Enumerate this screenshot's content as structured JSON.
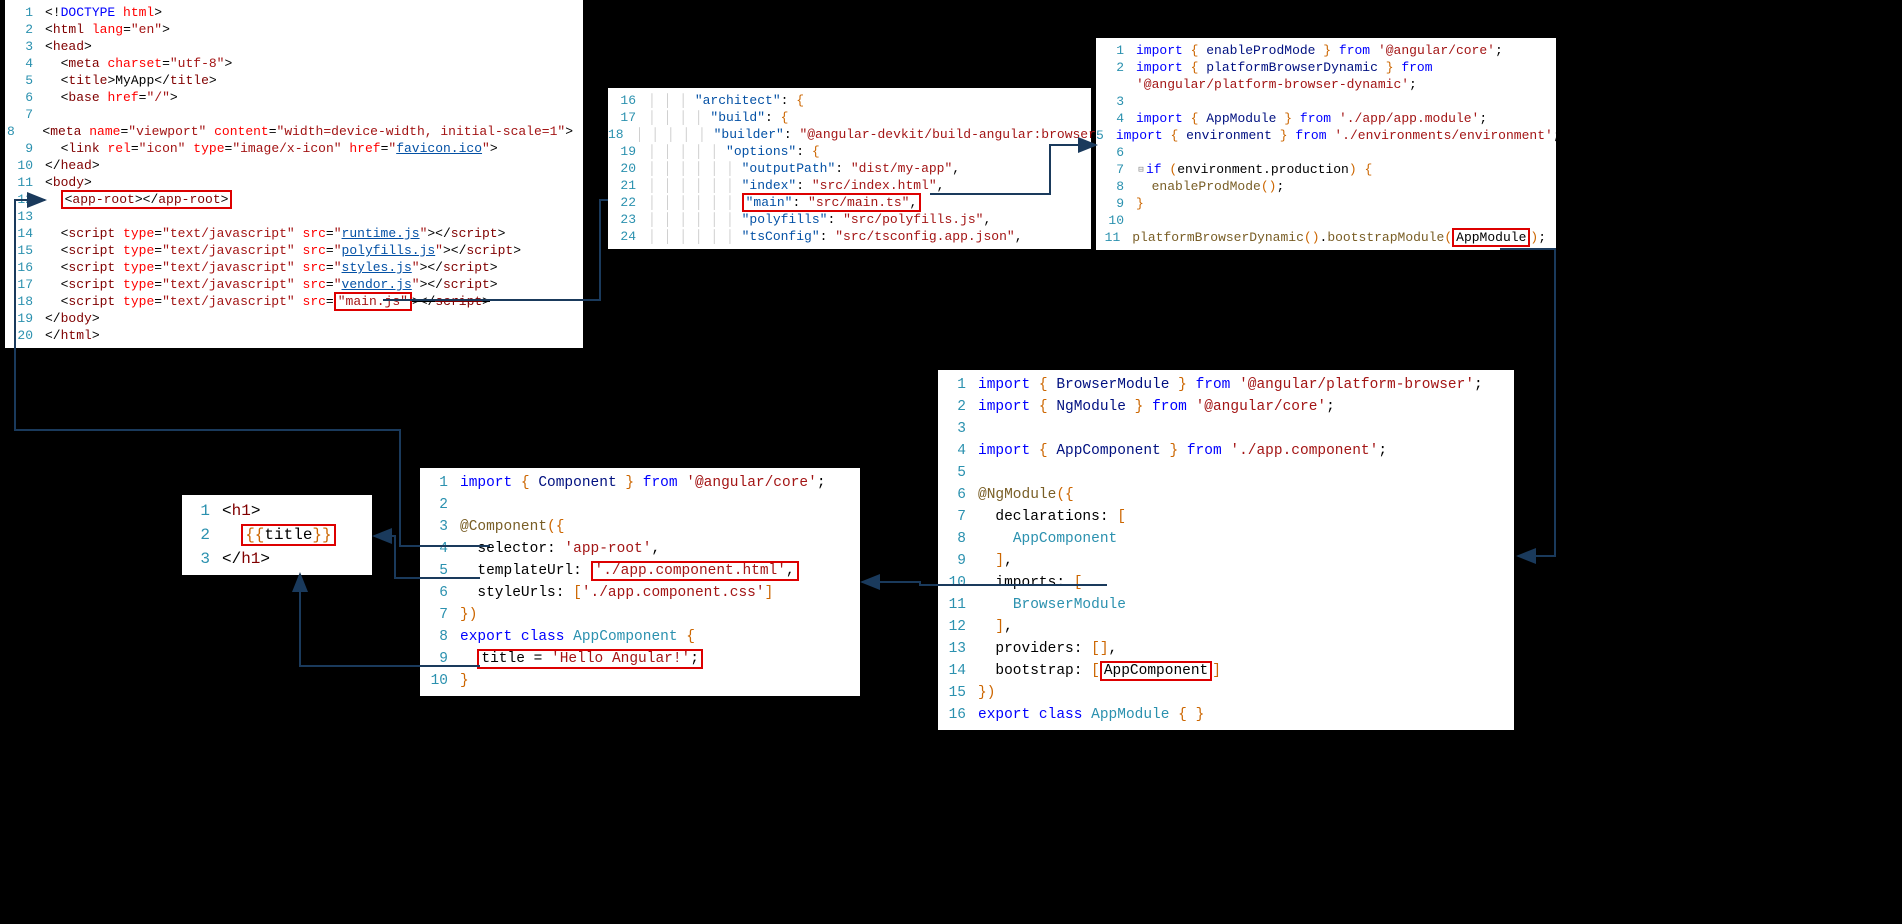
{
  "panel_index_html": {
    "lines": [
      {
        "n": "1",
        "html": "<span class='punct'>&lt;!</span><span class='kw'>DOCTYPE</span> <span class='attr'>html</span><span class='punct'>&gt;</span>"
      },
      {
        "n": "2",
        "html": "<span class='punct'>&lt;</span><span class='tag'>html</span> <span class='attr'>lang</span><span class='punct'>=</span><span class='str'>\"en\"</span><span class='punct'>&gt;</span>"
      },
      {
        "n": "3",
        "html": "<span class='punct'>&lt;</span><span class='tag'>head</span><span class='punct'>&gt;</span>"
      },
      {
        "n": "4",
        "html": "  <span class='punct'>&lt;</span><span class='tag'>meta</span> <span class='attr'>charset</span><span class='punct'>=</span><span class='str'>\"utf-8\"</span><span class='punct'>&gt;</span>"
      },
      {
        "n": "5",
        "html": "  <span class='punct'>&lt;</span><span class='tag'>title</span><span class='punct'>&gt;</span>MyApp<span class='punct'>&lt;/</span><span class='tag'>title</span><span class='punct'>&gt;</span>"
      },
      {
        "n": "6",
        "html": "  <span class='punct'>&lt;</span><span class='tag'>base</span> <span class='attr'>href</span><span class='punct'>=</span><span class='str'>\"/\"</span><span class='punct'>&gt;</span>"
      },
      {
        "n": "7",
        "html": " "
      },
      {
        "n": "8",
        "html": "  <span class='punct'>&lt;</span><span class='tag'>meta</span> <span class='attr'>name</span><span class='punct'>=</span><span class='str'>\"viewport\"</span> <span class='attr'>content</span><span class='punct'>=</span><span class='str'>\"width=device-width, initial-scale=1\"</span><span class='punct'>&gt;</span>"
      },
      {
        "n": "9",
        "html": "  <span class='punct'>&lt;</span><span class='tag'>link</span> <span class='attr'>rel</span><span class='punct'>=</span><span class='str'>\"icon\"</span> <span class='attr'>type</span><span class='punct'>=</span><span class='str'>\"image/x-icon\"</span> <span class='attr'>href</span><span class='punct'>=</span><span class='str'>\"<span class='link'>favicon.ico</span>\"</span><span class='punct'>&gt;</span>"
      },
      {
        "n": "10",
        "html": "<span class='punct'>&lt;/</span><span class='tag'>head</span><span class='punct'>&gt;</span>"
      },
      {
        "n": "11",
        "html": "<span class='punct'>&lt;</span><span class='tag'>body</span><span class='punct'>&gt;</span>"
      },
      {
        "n": "12",
        "html": "  <span class='red-box'><span class='punct'>&lt;</span><span class='tag'>app-root</span><span class='punct'>&gt;&lt;/</span><span class='tag'>app-root</span><span class='punct'>&gt;</span></span>"
      },
      {
        "n": "13",
        "html": " "
      },
      {
        "n": "14",
        "html": "  <span class='punct'>&lt;</span><span class='tag'>script</span> <span class='attr'>type</span><span class='punct'>=</span><span class='str'>\"text/javascript\"</span> <span class='attr'>src</span><span class='punct'>=</span><span class='str'>\"<span class='link'>runtime.js</span>\"</span><span class='punct'>&gt;&lt;/</span><span class='tag'>script</span><span class='punct'>&gt;</span>"
      },
      {
        "n": "15",
        "html": "  <span class='punct'>&lt;</span><span class='tag'>script</span> <span class='attr'>type</span><span class='punct'>=</span><span class='str'>\"text/javascript\"</span> <span class='attr'>src</span><span class='punct'>=</span><span class='str'>\"<span class='link'>polyfills.js</span>\"</span><span class='punct'>&gt;&lt;/</span><span class='tag'>script</span><span class='punct'>&gt;</span>"
      },
      {
        "n": "16",
        "html": "  <span class='punct'>&lt;</span><span class='tag'>script</span> <span class='attr'>type</span><span class='punct'>=</span><span class='str'>\"text/javascript\"</span> <span class='attr'>src</span><span class='punct'>=</span><span class='str'>\"<span class='link'>styles.js</span>\"</span><span class='punct'>&gt;&lt;/</span><span class='tag'>script</span><span class='punct'>&gt;</span>"
      },
      {
        "n": "17",
        "html": "  <span class='punct'>&lt;</span><span class='tag'>script</span> <span class='attr'>type</span><span class='punct'>=</span><span class='str'>\"text/javascript\"</span> <span class='attr'>src</span><span class='punct'>=</span><span class='str'>\"<span class='link'>vendor.js</span>\"</span><span class='punct'>&gt;&lt;/</span><span class='tag'>script</span><span class='punct'>&gt;</span>"
      },
      {
        "n": "18",
        "html": "  <span class='punct'>&lt;</span><span class='tag'>script</span> <span class='attr'>type</span><span class='punct'>=</span><span class='str'>\"text/javascript\"</span> <span class='attr'>src</span><span class='punct'>=</span><span class='red-box'><span class='str'>\"main.js\"</span></span><span class='punct' style='text-decoration:line-through'>&gt;&lt;/</span><span class='tag' style='text-decoration:line-through'>script</span><span class='punct' style='text-decoration:line-through'>&gt;</span>"
      },
      {
        "n": "19",
        "html": "<span class='punct'>&lt;/</span><span class='tag'>body</span><span class='punct'>&gt;</span>"
      },
      {
        "n": "20",
        "html": "<span class='punct'>&lt;/</span><span class='tag'>html</span><span class='punct'>&gt;</span>"
      }
    ]
  },
  "panel_angular_json": {
    "lines": [
      {
        "n": "16",
        "html": "<span class='guide'>│ │ │ </span><span class='str2'>\"architect\"</span>: <span class='brace-y'>{</span>"
      },
      {
        "n": "17",
        "html": "<span class='guide'>│ │ │ │ </span><span class='str2'>\"build\"</span>: <span class='brace-y'>{</span>"
      },
      {
        "n": "18",
        "html": "<span class='guide'>│ │ │ │ │ </span><span class='str2'>\"builder\"</span>: <span class='str'>\"@angular-devkit/build-angular:browser\"</span>,"
      },
      {
        "n": "19",
        "html": "<span class='guide'>│ │ │ │ │ </span><span class='str2'>\"options\"</span>: <span class='brace-y'>{</span>"
      },
      {
        "n": "20",
        "html": "<span class='guide'>│ │ │ │ │ │ </span><span class='str2'>\"outputPath\"</span>: <span class='str'>\"dist/my-app\"</span>,"
      },
      {
        "n": "21",
        "html": "<span class='guide'>│ │ │ │ │ │ </span><span class='str2'>\"index\"</span>: <span class='str'>\"src/index.html\"</span>,"
      },
      {
        "n": "22",
        "html": "<span class='guide'>│ │ │ │ │ │ </span><span class='red-box'><span class='str2'>\"main\"</span>: <span class='str'>\"src/main.ts\"</span>,</span>"
      },
      {
        "n": "23",
        "html": "<span class='guide'>│ │ │ │ │ │ </span><span class='str2'>\"polyfills\"</span>: <span class='str'>\"src/polyfills.js\"</span>,"
      },
      {
        "n": "24",
        "html": "<span class='guide'>│ │ │ │ │ │ </span><span class='str2'>\"tsConfig\"</span>: <span class='str'>\"src/tsconfig.app.json\"</span>,"
      }
    ]
  },
  "panel_main_ts": {
    "lines": [
      {
        "n": "1",
        "html": "<span class='kw'>import</span> <span class='brace-y'>{</span> <span class='prop'>enableProdMode</span> <span class='brace-y'>}</span> <span class='kw'>from</span> <span class='str'>'@angular/core'</span>;"
      },
      {
        "n": "2",
        "html": "<span class='kw'>import</span> <span class='brace-y'>{</span> <span class='prop'>platformBrowserDynamic</span> <span class='brace-y'>}</span> <span class='kw'>from</span>"
      },
      {
        "n": "",
        "html": "<span class='str'>'@angular/platform-browser-dynamic'</span>;"
      },
      {
        "n": "3",
        "html": " "
      },
      {
        "n": "4",
        "html": "<span class='kw'>import</span> <span class='brace-y'>{</span> <span class='prop'>AppModule</span> <span class='brace-y'>}</span> <span class='kw'>from</span> <span class='str'>'./app/app.module'</span>;"
      },
      {
        "n": "5",
        "html": "<span class='kw'>import</span> <span class='brace-y'>{</span> <span class='prop'>environment</span> <span class='brace-y'>}</span> <span class='kw'>from</span> <span class='str'>'./environments/environment'</span>;"
      },
      {
        "n": "6",
        "html": " "
      },
      {
        "n": "7",
        "html": "<span class='kw'>if</span> <span class='brace-y'>(</span>environment.production<span class='brace-y'>)</span> <span class='brace-y'>{</span>",
        "fold": "⊟"
      },
      {
        "n": "8",
        "html": "  <span class='func'>enableProdMode</span><span class='brace-y'>()</span>;"
      },
      {
        "n": "9",
        "html": "<span class='brace-y'>}</span>"
      },
      {
        "n": "10",
        "html": " "
      },
      {
        "n": "11",
        "html": "<span class='func'>platformBrowserDynamic</span><span class='brace-y'>()</span>.<span class='func'>bootstrapModule</span><span class='brace-y'>(</span><span class='red-box'>AppModule</span><span class='brace-y'>)</span>;"
      }
    ]
  },
  "panel_app_module": {
    "lines": [
      {
        "n": "1",
        "html": "<span class='kw'>import</span> <span class='brace-y'>{</span> <span class='prop'>BrowserModule</span> <span class='brace-y'>}</span> <span class='kw'>from</span> <span class='str'>'@angular/platform-browser'</span>;"
      },
      {
        "n": "2",
        "html": "<span class='kw'>import</span> <span class='brace-y'>{</span> <span class='prop'>NgModule</span> <span class='brace-y'>}</span> <span class='kw'>from</span> <span class='str'>'@angular/core'</span>;"
      },
      {
        "n": "3",
        "html": " "
      },
      {
        "n": "4",
        "html": "<span class='kw'>import</span> <span class='brace-y'>{</span> <span class='prop'>AppComponent</span> <span class='brace-y'>}</span> <span class='kw'>from</span> <span class='str'>'./app.component'</span>;"
      },
      {
        "n": "5",
        "html": " "
      },
      {
        "n": "6",
        "html": "<span class='deco'>@NgModule</span><span class='brace-y'>({</span>"
      },
      {
        "n": "7",
        "html": "  declarations: <span class='brace-y'>[</span>"
      },
      {
        "n": "8",
        "html": "    <span class='type'>AppComponent</span>"
      },
      {
        "n": "9",
        "html": "  <span class='brace-y'>]</span>,"
      },
      {
        "n": "10",
        "html": "  imports: <span class='brace-y'>[</span>"
      },
      {
        "n": "11",
        "html": "    <span class='type'>BrowserModule</span>"
      },
      {
        "n": "12",
        "html": "  <span class='brace-y'>]</span>,"
      },
      {
        "n": "13",
        "html": "  providers: <span class='brace-y'>[]</span>,"
      },
      {
        "n": "14",
        "html": "  bootstrap: <span class='brace-y'>[</span><span class='red-box'>AppComponent</span><span class='brace-y'>]</span>"
      },
      {
        "n": "15",
        "html": "<span class='brace-y'>})</span>"
      },
      {
        "n": "16",
        "html": "<span class='kw'>export</span> <span class='kw'>class</span> <span class='type'>AppModule</span> <span class='brace-y'>{ }</span>"
      }
    ]
  },
  "panel_app_component": {
    "lines": [
      {
        "n": "1",
        "html": "<span class='kw'>import</span> <span class='brace-y'>{</span> <span class='prop'>Component</span> <span class='brace-y'>}</span> <span class='kw'>from</span> <span class='str'>'@angular/core'</span>;"
      },
      {
        "n": "2",
        "html": " "
      },
      {
        "n": "3",
        "html": "<span class='deco'>@Component</span><span class='brace-y'>({</span>"
      },
      {
        "n": "4",
        "html": "  selector: <span class='str'>'app-root'</span>,"
      },
      {
        "n": "5",
        "html": "  templateUrl: <span class='red-box'><span class='str'>'./app.component.html'</span>,</span>"
      },
      {
        "n": "6",
        "html": "  styleUrls: <span class='brace-y'>[</span><span class='str'>'./app.component.css'</span><span class='brace-y'>]</span>"
      },
      {
        "n": "7",
        "html": "<span class='brace-y'>})</span>"
      },
      {
        "n": "8",
        "html": "<span class='kw'>export</span> <span class='kw'>class</span> <span class='type'>AppComponent</span> <span class='brace-y'>{</span>"
      },
      {
        "n": "9",
        "html": "  <span class='red-box'>title = <span class='str'>'Hello Angular!'</span>;</span>"
      },
      {
        "n": "10",
        "html": "<span class='brace-y'>}</span>"
      }
    ]
  },
  "panel_template": {
    "lines": [
      {
        "n": "1",
        "html": "<span class='punct'>&lt;</span><span class='tag'>h1</span><span class='punct'>&gt;</span>"
      },
      {
        "n": "2",
        "html": "  <span class='red-box'><span class='brace-y'>{{</span>title<span class='brace-y'>}}</span></span>"
      },
      {
        "n": "3",
        "html": "<span class='punct'>&lt;/</span><span class='tag'>h1</span><span class='punct'>&gt;</span>"
      }
    ]
  }
}
